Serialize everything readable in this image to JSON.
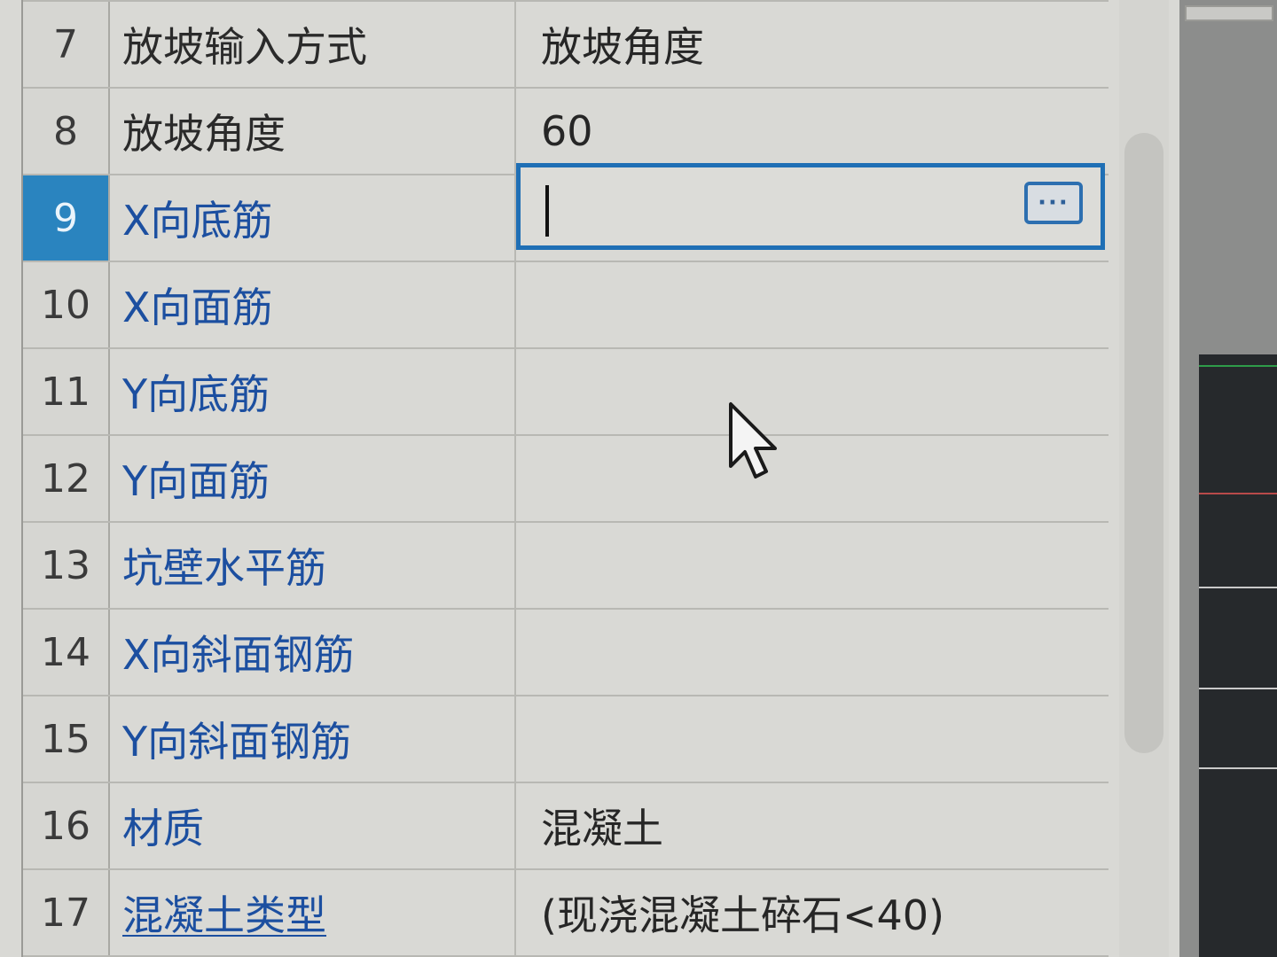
{
  "property_grid": {
    "rows": [
      {
        "num": "7",
        "name": "放坡输入方式",
        "value": "放坡角度",
        "name_style": "black"
      },
      {
        "num": "8",
        "name": "放坡角度",
        "value": "60",
        "name_style": "black"
      },
      {
        "num": "9",
        "name": "X向底筋",
        "value": "",
        "name_style": "blue",
        "selected": true
      },
      {
        "num": "10",
        "name": "X向面筋",
        "value": "",
        "name_style": "blue"
      },
      {
        "num": "11",
        "name": "Y向底筋",
        "value": "",
        "name_style": "blue"
      },
      {
        "num": "12",
        "name": "Y向面筋",
        "value": "",
        "name_style": "blue"
      },
      {
        "num": "13",
        "name": "坑壁水平筋",
        "value": "",
        "name_style": "blue"
      },
      {
        "num": "14",
        "name": "X向斜面钢筋",
        "value": "",
        "name_style": "blue"
      },
      {
        "num": "15",
        "name": "Y向斜面钢筋",
        "value": "",
        "name_style": "blue"
      },
      {
        "num": "16",
        "name": "材质",
        "value": "混凝土",
        "name_style": "blue"
      },
      {
        "num": "17",
        "name": "混凝土类型",
        "value": "(现浇混凝土碎石<40)",
        "name_style": "link"
      }
    ],
    "editor": {
      "row": "9",
      "value": "",
      "button_label": "···"
    }
  },
  "colors": {
    "selected_row_header": "#2a84bf",
    "editor_border": "#1f6fb5",
    "property_name_blue": "#1c4fa0"
  },
  "icons": {
    "cursor": "arrow-pointer-icon",
    "editor_button": "ellipsis-icon"
  }
}
